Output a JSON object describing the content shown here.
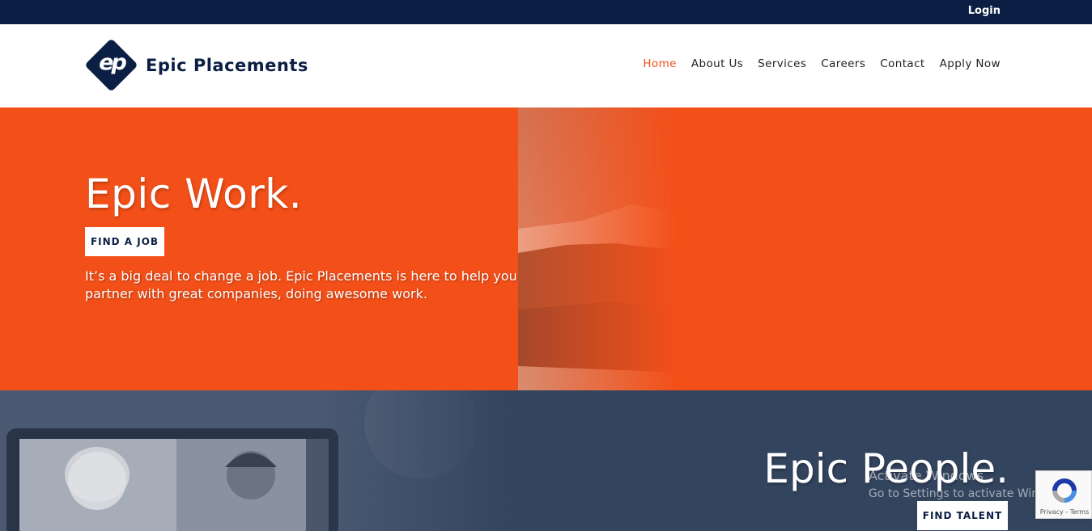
{
  "topbar": {
    "login": "Login"
  },
  "brand": {
    "logo_letters": "ep",
    "name": "Epic Placements"
  },
  "nav": {
    "items": [
      {
        "label": "Home",
        "active": true
      },
      {
        "label": "About Us",
        "active": false
      },
      {
        "label": "Services",
        "active": false
      },
      {
        "label": "Careers",
        "active": false
      },
      {
        "label": "Contact",
        "active": false
      },
      {
        "label": "Apply Now",
        "active": false
      }
    ]
  },
  "hero": {
    "title": "Epic Work.",
    "button": "FIND A JOB",
    "text": "It’s a big deal to change a job. Epic Placements is here to help you partner with great companies, doing awesome work."
  },
  "people": {
    "title": "Epic People.",
    "button": "FIND TALENT"
  },
  "watermark": {
    "line1": "Activate Windows",
    "line2": "Go to Settings to activate Windows."
  },
  "recaptcha": {
    "text": "Privacy - Terms"
  },
  "colors": {
    "navy": "#0b1f44",
    "orange": "#f34f18",
    "slate": "#33445e",
    "active_nav": "#f04d1a"
  }
}
